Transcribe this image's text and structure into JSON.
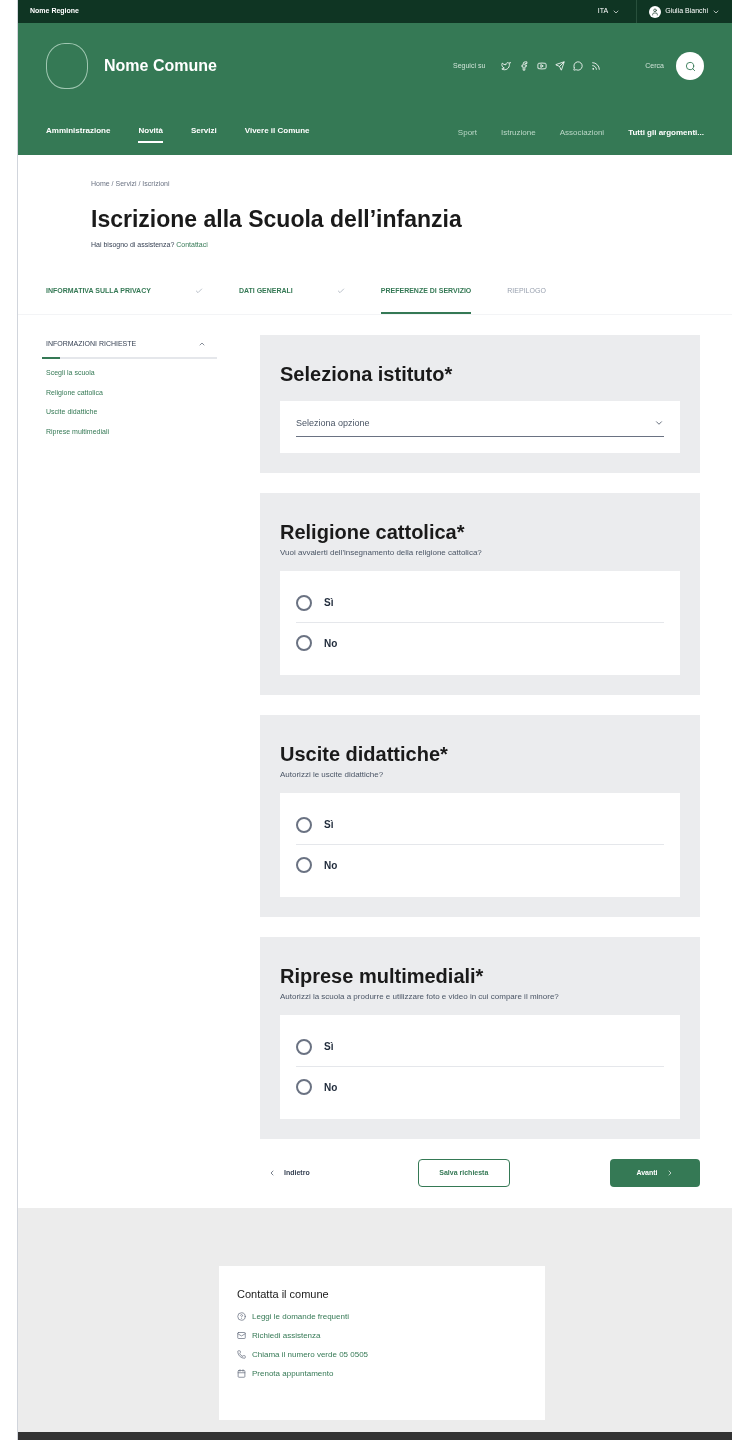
{
  "top_bar": {
    "region": "Nome Regione",
    "language": "ITA",
    "user": "Giulia Bianchi"
  },
  "header": {
    "name": "Nome Comune",
    "follow_label": "Seguici su",
    "search_label": "Cerca"
  },
  "nav": {
    "main": [
      {
        "label": "Amministrazione",
        "selected": false
      },
      {
        "label": "Novità",
        "selected": true
      },
      {
        "label": "Servizi",
        "selected": false
      },
      {
        "label": "Vivere il Comune",
        "selected": false
      }
    ],
    "topics": [
      {
        "label": "Sport",
        "kind": "topic"
      },
      {
        "label": "Istruzione",
        "kind": "topic"
      },
      {
        "label": "Associazioni",
        "kind": "topic"
      },
      {
        "label": "Tutti gli argomenti...",
        "kind": "all"
      }
    ]
  },
  "breadcrumb": "Home / Servizi / Iscrizioni",
  "title": "Iscrizione alla Scuola dell’infanzia",
  "help": {
    "text": "Hai bisogno di assistenza?",
    "link": "Contattaci"
  },
  "steps": [
    {
      "label": "INFORMATIVA SULLA PRIVACY",
      "completed": true,
      "selected": false
    },
    {
      "label": "DATI GENERALI",
      "completed": true,
      "selected": false
    },
    {
      "label": "PREFERENZE DI SERVIZIO",
      "completed": false,
      "selected": true
    },
    {
      "label": "RIEPILOGO",
      "completed": false,
      "selected": false
    }
  ],
  "sidebar": {
    "title": "INFORMAZIONI RICHIESTE",
    "expanded": true,
    "level": 0.1,
    "items": [
      "Scegli la scuola",
      "Religione cattolica",
      "Uscite didattiche",
      "Riprese multimediali"
    ]
  },
  "sections": [
    {
      "kind": "select",
      "title": "Seleziona istituto*",
      "placeholder": "Seleziona opzione"
    },
    {
      "kind": "radio",
      "title": "Religione cattolica*",
      "question": "Vuoi avvalerti dell'insegnamento della religione cattolica?",
      "options": [
        {
          "label": "Sì",
          "selected": false
        },
        {
          "label": "No",
          "selected": false
        }
      ]
    },
    {
      "kind": "radio",
      "title": "Uscite didattiche*",
      "question": "Autorizzi le uscite didattiche?",
      "options": [
        {
          "label": "Sì",
          "selected": false
        },
        {
          "label": "No",
          "selected": false
        }
      ]
    },
    {
      "kind": "radio",
      "title": "Riprese multimediali*",
      "question": "Autorizzi la scuola a produrre e utilizzare foto e video in cui compare il minore?",
      "options": [
        {
          "label": "Sì",
          "selected": false
        },
        {
          "label": "No",
          "selected": false
        }
      ]
    }
  ],
  "buttons": {
    "back": "Indietro",
    "save": "Salva richiesta",
    "next": "Avanti"
  },
  "contact": {
    "title": "Contatta il comune",
    "links": [
      "Leggi le domande frequenti",
      "Richiedi assistenza",
      "Chiama il numero verde 05 0505",
      "Prenota appuntamento"
    ]
  }
}
